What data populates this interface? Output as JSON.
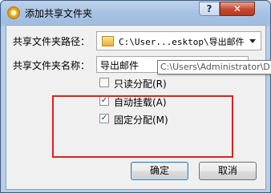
{
  "window": {
    "title": "添加共享文件夹",
    "help_label": "?",
    "close_label": "✕"
  },
  "form": {
    "path_label": "共享文件夹路径：",
    "path_value": "C:\\User...esktop\\导出邮件",
    "name_label": "共享文件夹名称：",
    "name_value": "导出邮件",
    "tooltip_text": "C:\\Users\\Administrator\\D"
  },
  "options": [
    {
      "label": "只读分配(R)",
      "checked": false
    },
    {
      "label": "自动挂载(A)",
      "checked": true
    },
    {
      "label": "固定分配(M)",
      "checked": true
    }
  ],
  "buttons": {
    "ok": "确定",
    "cancel": "取消"
  },
  "icons": {
    "title": "gear-icon",
    "folder": "folder-icon",
    "dropdown": "chevron-down-icon"
  },
  "colors": {
    "highlight": "#e0211b"
  }
}
